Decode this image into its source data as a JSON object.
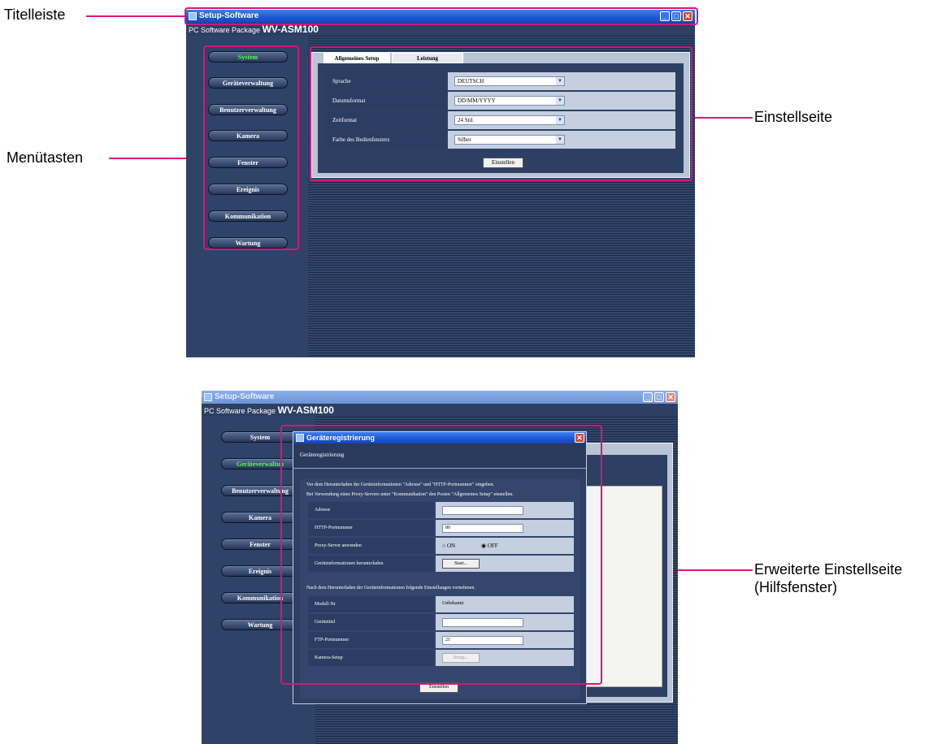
{
  "callouts": {
    "title_bar": "Titelleiste",
    "menu_buttons": "Menütasten",
    "settings_page": "Einstellseite",
    "extended_line1": "Erweiterte Einstellseite",
    "extended_line2": "(Hilfsfenster)"
  },
  "app": {
    "title": "Setup-Software",
    "package_prefix": "PC Software Package",
    "package_model": "WV-ASM100"
  },
  "menu": [
    "System",
    "Geräteverwaltung",
    "Benutzerverwaltung",
    "Kamera",
    "Fenster",
    "Ereignis",
    "Kommunikation",
    "Wartung"
  ],
  "menu_bottom_labels": [
    "System",
    "Geräteverwaltun",
    "Benutzerverwaltung",
    "Kamera",
    "Fenster",
    "Ereignis",
    "Kommunikation",
    "Wartung"
  ],
  "settings": {
    "tabs": [
      "Allgemeines Setup",
      "Leistung"
    ],
    "rows": [
      {
        "label": "Sprache",
        "value": "DEUTSCH"
      },
      {
        "label": "Datumsformat",
        "value": "DD/MM/YYYY"
      },
      {
        "label": "Zeitformat",
        "value": "24 Std."
      },
      {
        "label": "Farbe des Bedienfensters",
        "value": "Silber"
      }
    ],
    "apply": "Einstellen"
  },
  "dialog": {
    "title": "Geräteregistrierung",
    "heading": "Geräteregistrierung",
    "info1": "Vor dem Herunterladen der Geräteinformationen \"Adresse\" und \"HTTP-Portnummer\" eingeben.",
    "info2": "Bei Verwendung eines Proxy-Servers unter \"Kommunikation\" den Posten \"Allgemeines Setup\" einstellen.",
    "address_label": "Adresse",
    "address_value": "",
    "http_label": "HTTP-Portnummer",
    "http_value": "80",
    "proxy_label": "Proxy-Server anwenden",
    "proxy_on": "ON",
    "proxy_off": "OFF",
    "download_label": "Geräteinformationen herunterladen",
    "start": "Start...",
    "info3": "Nach dem Herunterladen der Geräteinformationen folgende Einstellungen vornehmen.",
    "model_label": "Modell-Nr.",
    "model_value": "Unbekannt",
    "device_title_label": "Gerätetitel",
    "device_title_value": "",
    "ftp_label": "FTP-Portnummer",
    "ftp_value": "21",
    "camera_label": "Kamera-Setup",
    "camera_btn": "Setup...",
    "apply": "Einstellen"
  }
}
